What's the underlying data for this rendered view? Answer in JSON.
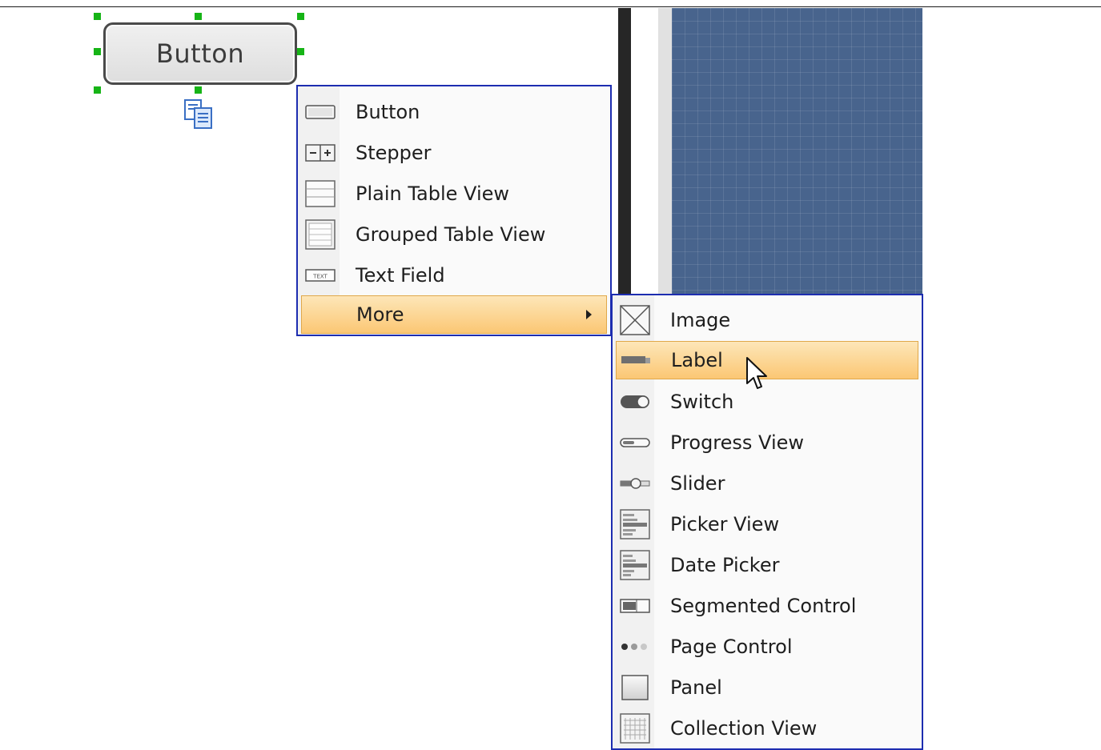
{
  "canvas": {
    "selected_shape_label": "Button"
  },
  "context_menu": {
    "items": [
      {
        "label": "Button",
        "icon": "button-icon"
      },
      {
        "label": "Stepper",
        "icon": "stepper-icon"
      },
      {
        "label": "Plain Table View",
        "icon": "plain-table-view-icon"
      },
      {
        "label": "Grouped Table View",
        "icon": "grouped-table-view-icon"
      },
      {
        "label": "Text Field",
        "icon": "text-field-icon"
      },
      {
        "label": "More",
        "icon": "",
        "submenu": true,
        "highlighted": true
      }
    ]
  },
  "more_submenu": {
    "items": [
      {
        "label": "Image",
        "icon": "image-icon"
      },
      {
        "label": "Label",
        "icon": "label-icon",
        "highlighted": true
      },
      {
        "label": "Switch",
        "icon": "switch-icon"
      },
      {
        "label": "Progress View",
        "icon": "progress-view-icon"
      },
      {
        "label": "Slider",
        "icon": "slider-icon"
      },
      {
        "label": "Picker View",
        "icon": "picker-view-icon"
      },
      {
        "label": "Date Picker",
        "icon": "date-picker-icon"
      },
      {
        "label": "Segmented Control",
        "icon": "segmented-control-icon"
      },
      {
        "label": "Page Control",
        "icon": "page-control-icon"
      },
      {
        "label": "Panel",
        "icon": "panel-icon"
      },
      {
        "label": "Collection View",
        "icon": "collection-view-icon"
      }
    ]
  },
  "text_field_icon_text": "TEXT",
  "colors": {
    "menu_border": "#1d2db0",
    "highlight": "#fbc774",
    "selection_handle": "#16b416",
    "blueprint": "#48648d"
  }
}
